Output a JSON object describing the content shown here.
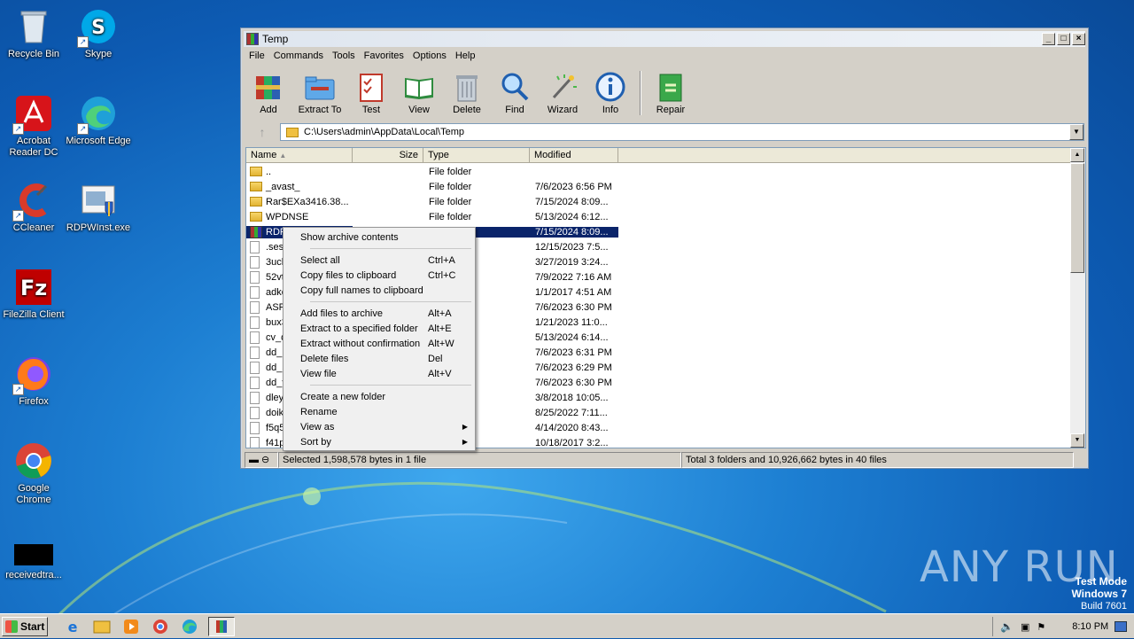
{
  "desktop": {
    "icons": [
      {
        "label": "Recycle Bin"
      },
      {
        "label": "Skype"
      },
      {
        "label": "Acrobat Reader DC"
      },
      {
        "label": "Microsoft Edge"
      },
      {
        "label": "CCleaner"
      },
      {
        "label": "RDPWInst.exe"
      },
      {
        "label": "FileZilla Client"
      },
      {
        "label": "Firefox"
      },
      {
        "label": "Google Chrome"
      },
      {
        "label": "receivedtra..."
      }
    ]
  },
  "window": {
    "title": "Temp",
    "menu": [
      "File",
      "Commands",
      "Tools",
      "Favorites",
      "Options",
      "Help"
    ],
    "toolbar": [
      "Add",
      "Extract To",
      "Test",
      "View",
      "Delete",
      "Find",
      "Wizard",
      "Info",
      "Repair"
    ],
    "address": "C:\\Users\\admin\\AppData\\Local\\Temp",
    "columns": [
      "Name",
      "Size",
      "Type",
      "Modified"
    ],
    "rows": [
      {
        "name": "..",
        "size": "",
        "type": "File folder",
        "modified": "",
        "icon": "folder"
      },
      {
        "name": "_avast_",
        "size": "",
        "type": "File folder",
        "modified": "7/6/2023 6:56 PM",
        "icon": "folder"
      },
      {
        "name": "Rar$EXa3416.38...",
        "size": "",
        "type": "File folder",
        "modified": "7/15/2024 8:09...",
        "icon": "folder"
      },
      {
        "name": "WPDNSE",
        "size": "",
        "type": "File folder",
        "modified": "5/13/2024 6:12...",
        "icon": "folder"
      },
      {
        "name": "RDP",
        "size": "",
        "type": "P archive",
        "modified": "7/15/2024 8:09...",
        "icon": "rar"
      },
      {
        "name": ".ses",
        "size": "",
        "type": "",
        "modified": "12/15/2023 7:5...",
        "icon": "file"
      },
      {
        "name": "3uch",
        "size": "",
        "type": "",
        "modified": "3/27/2019 3:24...",
        "icon": "file"
      },
      {
        "name": "52vt",
        "size": "",
        "type": "",
        "modified": "7/9/2022 7:16 AM",
        "icon": "file"
      },
      {
        "name": "adko",
        "size": "",
        "type": "",
        "modified": "1/1/2017 4:51 AM",
        "icon": "file"
      },
      {
        "name": "ASPI",
        "size": "",
        "type": "ment",
        "modified": "7/6/2023 6:30 PM",
        "icon": "file"
      },
      {
        "name": "bux3",
        "size": "",
        "type": "",
        "modified": "1/21/2023 11:0...",
        "icon": "file"
      },
      {
        "name": "cv_d",
        "size": "",
        "type": "ment",
        "modified": "5/13/2024 6:14...",
        "icon": "file"
      },
      {
        "name": "dd_n",
        "size": "",
        "type": "ment",
        "modified": "7/6/2023 6:31 PM",
        "icon": "file"
      },
      {
        "name": "dd_S",
        "size": "",
        "type": "ment",
        "modified": "7/6/2023 6:29 PM",
        "icon": "file"
      },
      {
        "name": "dd_v",
        "size": "",
        "type": "ment",
        "modified": "7/6/2023 6:30 PM",
        "icon": "file"
      },
      {
        "name": "dley",
        "size": "",
        "type": "",
        "modified": "3/8/2018 10:05...",
        "icon": "file"
      },
      {
        "name": "doikl",
        "size": "",
        "type": "",
        "modified": "8/25/2022 7:11...",
        "icon": "file"
      },
      {
        "name": "f5q5",
        "size": "",
        "type": "",
        "modified": "4/14/2020 8:43...",
        "icon": "file"
      },
      {
        "name": "f41p",
        "size": "",
        "type": "",
        "modified": "10/18/2017 3:2...",
        "icon": "file"
      }
    ],
    "status_left": "Selected 1,598,578 bytes in 1 file",
    "status_right": "Total 3 folders and 10,926,662 bytes in 40 files"
  },
  "context_menu": {
    "groups": [
      [
        {
          "label": "Show archive contents",
          "shortcut": ""
        }
      ],
      [
        {
          "label": "Select all",
          "shortcut": "Ctrl+A"
        },
        {
          "label": "Copy files to clipboard",
          "shortcut": "Ctrl+C"
        },
        {
          "label": "Copy full names to clipboard",
          "shortcut": ""
        }
      ],
      [
        {
          "label": "Add files to archive",
          "shortcut": "Alt+A"
        },
        {
          "label": "Extract to a specified folder",
          "shortcut": "Alt+E"
        },
        {
          "label": "Extract without confirmation",
          "shortcut": "Alt+W"
        },
        {
          "label": "Delete files",
          "shortcut": "Del"
        },
        {
          "label": "View file",
          "shortcut": "Alt+V"
        }
      ],
      [
        {
          "label": "Create a new folder",
          "shortcut": ""
        },
        {
          "label": "Rename",
          "shortcut": ""
        },
        {
          "label": "View as",
          "shortcut": "",
          "submenu": true
        },
        {
          "label": "Sort by",
          "shortcut": "",
          "submenu": true
        }
      ]
    ]
  },
  "taskbar": {
    "start_label": "Start",
    "clock": "8:10 PM"
  },
  "watermark": {
    "line1": "Test Mode",
    "line2": "Windows 7",
    "line3": "Build 7601",
    "brand": "ANY RUN"
  }
}
